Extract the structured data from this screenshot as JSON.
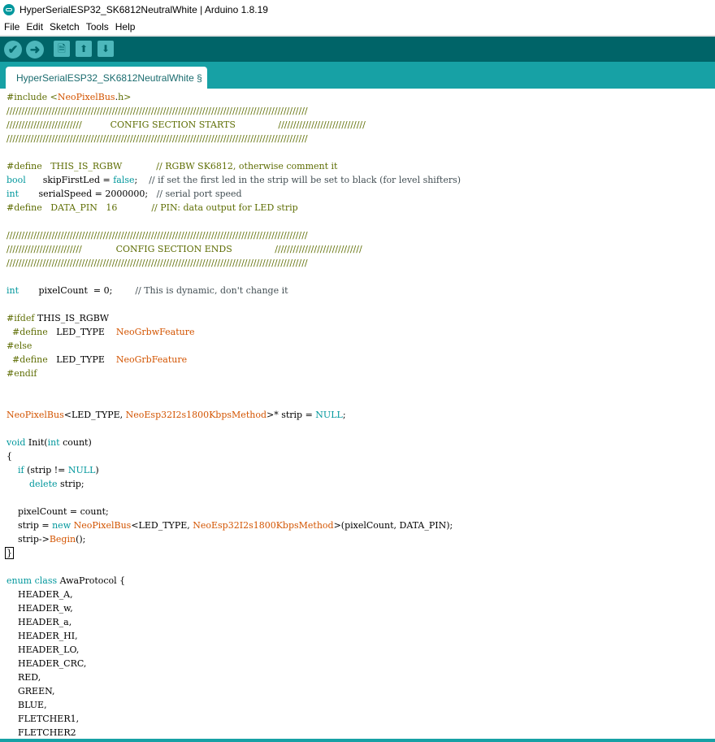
{
  "window": {
    "title": "HyperSerialESP32_SK6812NeutralWhite | Arduino 1.8.19",
    "icon": "arduino-logo-icon"
  },
  "menu": [
    "File",
    "Edit",
    "Sketch",
    "Tools",
    "Help"
  ],
  "toolbar": [
    {
      "name": "verify-button",
      "icon": "checkmark-icon",
      "glyph": "✔",
      "shape": "round"
    },
    {
      "name": "upload-button",
      "icon": "arrow-right-icon",
      "glyph": "➜",
      "shape": "round"
    },
    {
      "name": "new-button",
      "icon": "new-file-icon",
      "glyph": "🗎",
      "shape": "square"
    },
    {
      "name": "open-button",
      "icon": "arrow-up-icon",
      "glyph": "⬆",
      "shape": "square"
    },
    {
      "name": "save-button",
      "icon": "arrow-down-icon",
      "glyph": "⬇",
      "shape": "square"
    }
  ],
  "tab": {
    "label": "HyperSerialESP32_SK6812NeutralWhite §"
  },
  "colors": {
    "toolbar_bg": "#006468",
    "tabbar_bg": "#17a1a5",
    "keyword": "#00979c",
    "library": "#d35400"
  },
  "code": [
    [
      [
        "pre",
        "#include <"
      ],
      [
        "lib",
        "NeoPixelBus"
      ],
      [
        "",
        "."
      ],
      [
        "pre",
        "h>"
      ]
    ],
    [
      [
        "pre",
        "////////////////////////////////////////////////////////////////////////////////////////////////////"
      ]
    ],
    [
      [
        "pre",
        "/////////////////////////          CONFIG SECTION STARTS               /////////////////////////////"
      ]
    ],
    [
      [
        "pre",
        "////////////////////////////////////////////////////////////////////////////////////////////////////"
      ]
    ],
    [],
    [
      [
        "pre",
        "#define   THIS_IS_RGBW            // RGBW SK6812, otherwise comment it"
      ]
    ],
    [
      [
        "kw",
        "bool"
      ],
      [
        "",
        "      skipFirstLed = "
      ],
      [
        "kw",
        "false"
      ],
      [
        "",
        ";    "
      ],
      [
        "cmt",
        "// if set the first led in the strip will be set to black (for level shifters)"
      ]
    ],
    [
      [
        "kw",
        "int"
      ],
      [
        "",
        "       serialSpeed = 2000000;   "
      ],
      [
        "cmt",
        "// serial port speed"
      ]
    ],
    [
      [
        "pre",
        "#define   DATA_PIN   16            // PIN: data output for LED strip"
      ]
    ],
    [],
    [
      [
        "pre",
        "////////////////////////////////////////////////////////////////////////////////////////////////////"
      ]
    ],
    [
      [
        "pre",
        "/////////////////////////            CONFIG SECTION ENDS               /////////////////////////////"
      ]
    ],
    [
      [
        "pre",
        "////////////////////////////////////////////////////////////////////////////////////////////////////"
      ]
    ],
    [],
    [
      [
        "kw",
        "int"
      ],
      [
        "",
        "       pixelCount  = 0;        "
      ],
      [
        "cmt",
        "// This is dynamic, don't change it"
      ]
    ],
    [],
    [
      [
        "pre",
        "#ifdef"
      ],
      [
        "",
        " THIS_IS_RGBW"
      ]
    ],
    [
      [
        "",
        "  "
      ],
      [
        "pre",
        "#define"
      ],
      [
        "",
        "   LED_TYPE    "
      ],
      [
        "lib",
        "NeoGrbwFeature"
      ]
    ],
    [
      [
        "pre",
        "#else"
      ]
    ],
    [
      [
        "",
        "  "
      ],
      [
        "pre",
        "#define"
      ],
      [
        "",
        "   LED_TYPE    "
      ],
      [
        "lib",
        "NeoGrbFeature"
      ]
    ],
    [
      [
        "pre",
        "#endif"
      ]
    ],
    [],
    [],
    [
      [
        "lib",
        "NeoPixelBus"
      ],
      [
        "",
        "<LED_TYPE, "
      ],
      [
        "lib",
        "NeoEsp32I2s1800KbpsMethod"
      ],
      [
        "",
        ">* strip = "
      ],
      [
        "kw",
        "NULL"
      ],
      [
        "",
        ";"
      ]
    ],
    [],
    [
      [
        "kw",
        "void"
      ],
      [
        "",
        " Init("
      ],
      [
        "kw",
        "int"
      ],
      [
        "",
        " count)"
      ]
    ],
    [
      [
        "",
        "{"
      ]
    ],
    [
      [
        "",
        "    "
      ],
      [
        "kw",
        "if"
      ],
      [
        "",
        " (strip != "
      ],
      [
        "kw",
        "NULL"
      ],
      [
        "",
        ")"
      ]
    ],
    [
      [
        "",
        "        "
      ],
      [
        "kw",
        "delete"
      ],
      [
        "",
        " strip;"
      ]
    ],
    [],
    [
      [
        "",
        "    pixelCount = count;"
      ]
    ],
    [
      [
        "",
        "    strip = "
      ],
      [
        "kw",
        "new"
      ],
      [
        "",
        " "
      ],
      [
        "lib",
        "NeoPixelBus"
      ],
      [
        "",
        "<LED_TYPE, "
      ],
      [
        "lib",
        "NeoEsp32I2s1800KbpsMethod"
      ],
      [
        "",
        ">(pixelCount, DATA_PIN);"
      ]
    ],
    [
      [
        "",
        "    strip->"
      ],
      [
        "lib",
        "Begin"
      ],
      [
        "",
        "();"
      ]
    ],
    [
      [
        "box",
        "}"
      ]
    ],
    [],
    [
      [
        "kw",
        "enum"
      ],
      [
        "",
        " "
      ],
      [
        "kw",
        "class"
      ],
      [
        "",
        " AwaProtocol {"
      ]
    ],
    [
      [
        "",
        "    HEADER_A,"
      ]
    ],
    [
      [
        "",
        "    HEADER_w,"
      ]
    ],
    [
      [
        "",
        "    HEADER_a,"
      ]
    ],
    [
      [
        "",
        "    HEADER_HI,"
      ]
    ],
    [
      [
        "",
        "    HEADER_LO,"
      ]
    ],
    [
      [
        "",
        "    HEADER_CRC,"
      ]
    ],
    [
      [
        "",
        "    RED,"
      ]
    ],
    [
      [
        "",
        "    GREEN,"
      ]
    ],
    [
      [
        "",
        "    BLUE,"
      ]
    ],
    [
      [
        "",
        "    FLETCHER1,"
      ]
    ],
    [
      [
        "",
        "    FLETCHER2"
      ]
    ]
  ]
}
